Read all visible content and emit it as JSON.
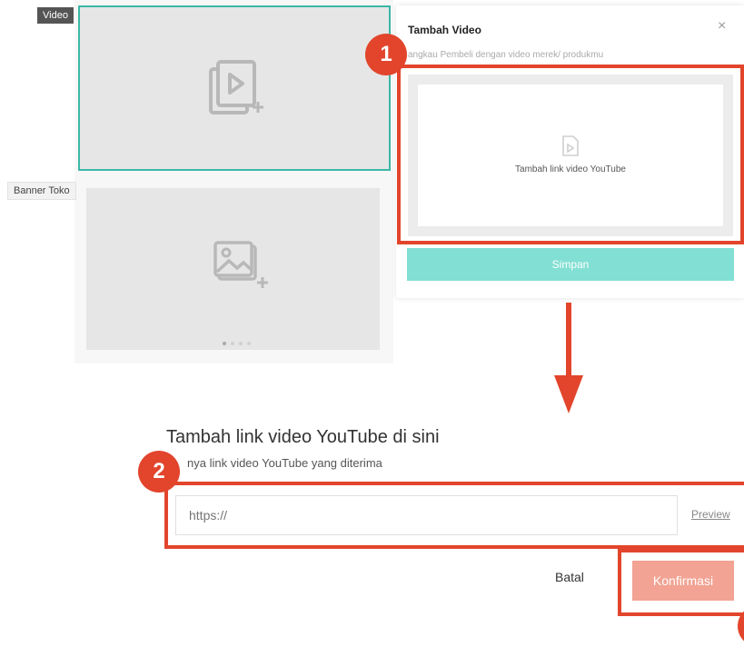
{
  "editor": {
    "video_tag": "Video",
    "banner_tag": "Banner Toko"
  },
  "modal": {
    "title": "Tambah Video",
    "close": "×",
    "subtitle": "angkau Pembeli dengan video merek/ produkmu",
    "upload_label": "Tambah link video YouTube",
    "save_label": "Simpan"
  },
  "link_form": {
    "title": "Tambah link video YouTube di sini",
    "note": "nya link video YouTube yang diterima",
    "url_placeholder": "https://",
    "preview_label": "Preview",
    "cancel_label": "Batal",
    "confirm_label": "Konfirmasi"
  },
  "annotations": {
    "badge_1": "1",
    "badge_2": "2",
    "accent_color": "#e2452c"
  },
  "colors": {
    "primary_teal": "#82dfd3",
    "selected_border": "#3bb7a7",
    "confirm_disabled": "#f2a393"
  },
  "icons": {
    "video_slot": "video-add-icon",
    "banner_slot": "image-add-icon",
    "upload": "video-file-icon"
  }
}
